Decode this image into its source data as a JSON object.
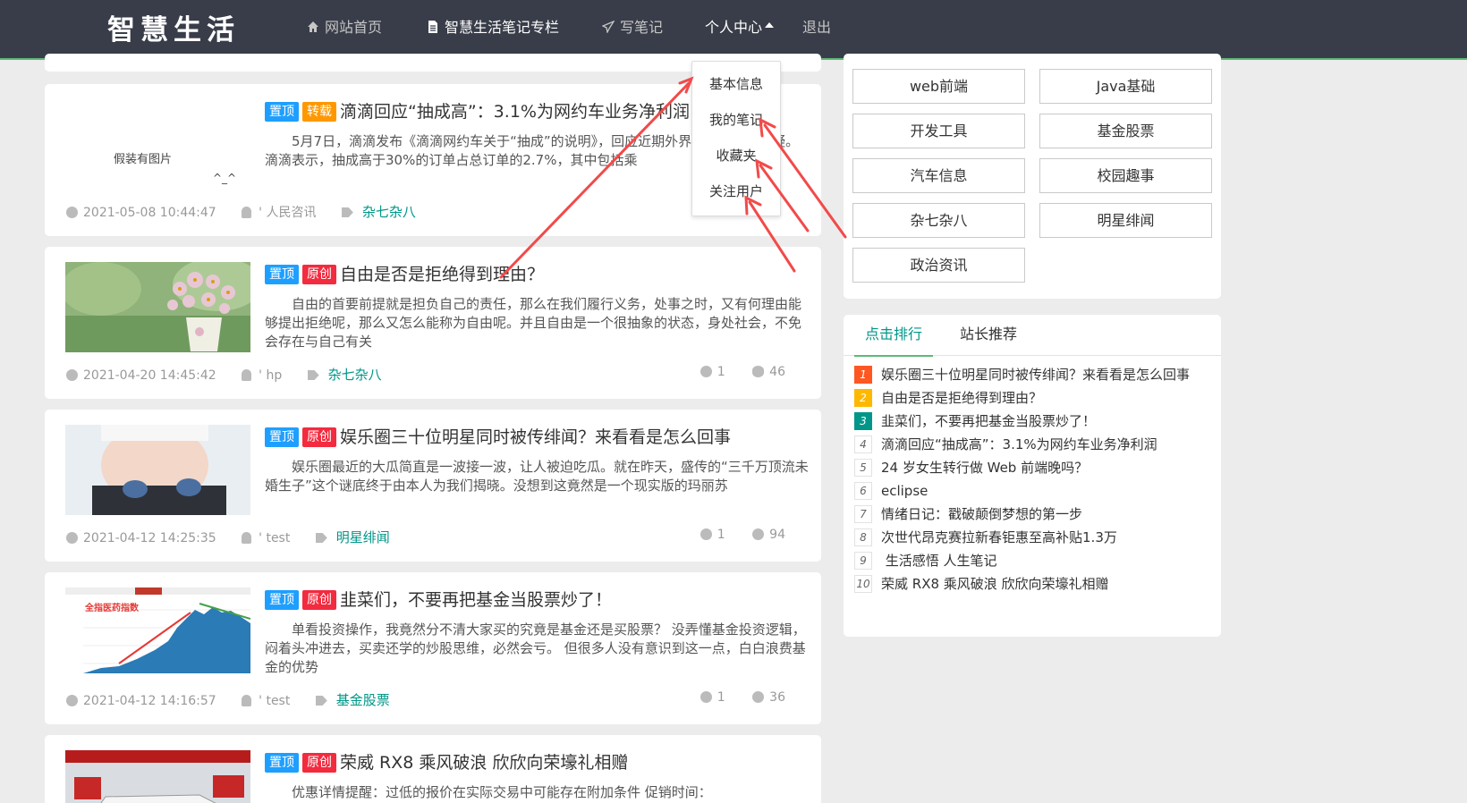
{
  "site": {
    "logo": "智慧生活"
  },
  "nav": {
    "home": "网站首页",
    "column": "智慧生活笔记专栏",
    "write": "写笔记",
    "personal": "个人中心",
    "logout": "退出"
  },
  "dropdown": [
    "基本信息",
    "我的笔记",
    "收藏夹",
    "关注用户"
  ],
  "posts": [
    {
      "badges": [
        "置顶",
        "转载"
      ],
      "title": "滴滴回应“抽成高”：3.1%为网约车业务净利润",
      "excerpt": "5月7日，滴滴发布《滴滴网约车关于“抽成”的说明》，回应近期外界关于滴滴的质疑。滴滴表示，抽成高于30%的订单占总订单的2.7%，其中包括乘",
      "thumb_text": "假装有图片",
      "thumb_face": "^_^",
      "date": "2021-05-08 10:44:47",
      "author": "' 人民咨讯",
      "tag": "杂七杂八"
    },
    {
      "badges": [
        "置顶",
        "原创"
      ],
      "title": "自由是否是拒绝得到理由？",
      "excerpt": "自由的首要前提就是担负自己的责任，那么在我们履行义务，处事之时，又有何理由能够提出拒绝呢，那么又怎么能称为自由呢。并且自由是一个很抽象的状态，身处社会，不免会存在与自己有关",
      "date": "2021-04-20 14:45:42",
      "author": "' hp",
      "tag": "杂七杂八",
      "comments": "1",
      "views": "46"
    },
    {
      "badges": [
        "置顶",
        "原创"
      ],
      "title": "娱乐圈三十位明星同时被传绯闻？来看看是怎么回事",
      "excerpt": "娱乐圈最近的大瓜简直是一波接一波，让人被迫吃瓜。就在昨天，盛传的“三千万顶流未婚生子”这个谜底终于由本人为我们揭晓。没想到这竟然是一个现实版的玛丽苏",
      "date": "2021-04-12 14:25:35",
      "author": "' test",
      "tag": "明星绯闻",
      "comments": "1",
      "views": "94"
    },
    {
      "badges": [
        "置顶",
        "原创"
      ],
      "title": "韭菜们，不要再把基金当股票炒了！",
      "excerpt": "单看投资操作，我竟然分不清大家买的究竟是基金还是买股票？ 没弄懂基金投资逻辑，闷着头冲进去，买卖还学的炒股思维，必然会亏。 但很多人没有意识到这一点，白白浪费基金的优势",
      "chart_label": "全指医药指数",
      "date": "2021-04-12 14:16:57",
      "author": "' test",
      "tag": "基金股票",
      "comments": "1",
      "views": "36"
    },
    {
      "badges": [
        "置顶",
        "原创"
      ],
      "title": "荣威 RX8 乘风破浪 欣欣向荣壕礼相赠",
      "excerpt": "优惠详情提醒：过低的报价在实际交易中可能存在附加条件 促销时间："
    }
  ],
  "categories": [
    "web前端",
    "Java基础",
    "开发工具",
    "基金股票",
    "汽车信息",
    "校园趣事",
    "杂七杂八",
    "明星绯闻",
    "政治资讯"
  ],
  "rank_tabs": [
    "点击排行",
    "站长推荐"
  ],
  "ranking": [
    {
      "num": "1",
      "title": "娱乐圈三十位明星同时被传绯闻？来看看是怎么回事"
    },
    {
      "num": "2",
      "title": "自由是否是拒绝得到理由？"
    },
    {
      "num": "3",
      "title": "韭菜们，不要再把基金当股票炒了！"
    },
    {
      "num": "4",
      "title": "滴滴回应“抽成高”：3.1%为网约车业务净利润"
    },
    {
      "num": "5",
      "title": "24 岁女生转行做 Web 前端晚吗？"
    },
    {
      "num": "6",
      "title": "eclipse"
    },
    {
      "num": "7",
      "title": "情绪日记：戳破颠倒梦想的第一步"
    },
    {
      "num": "8",
      "title": "次世代昂克赛拉新春钜惠至高补贴1.3万"
    },
    {
      "num": "9",
      "title": " 生活感悟 人生笔记"
    },
    {
      "num": "10",
      "title": "荣威 RX8 乘风破浪 欣欣向荣壕礼相赠"
    }
  ],
  "colors": {
    "nav_bg": "#393d49",
    "accent": "#5fb878",
    "tag": "#009688",
    "badge_top": "#1e9fff",
    "badge_repost": "#ff9800",
    "badge_original": "#f32b3f",
    "annotation_arrow": "#f24a4a"
  }
}
